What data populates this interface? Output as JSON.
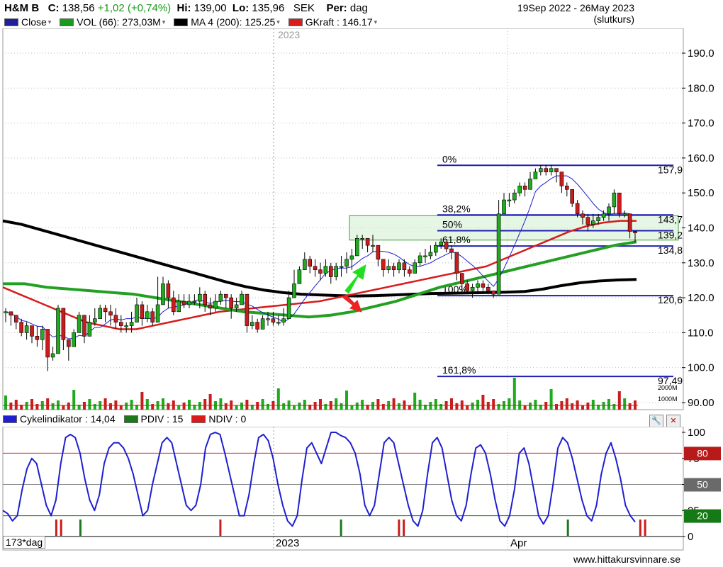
{
  "header": {
    "symbol": "H&M B",
    "close_label": "C:",
    "close_value": "138,56",
    "change": "+1,02 (+0,74%)",
    "hi_label": "Hi:",
    "hi_value": "139,00",
    "lo_label": "Lo:",
    "lo_value": "135,96",
    "currency": "SEK",
    "per_label": "Per:",
    "per_value": "dag",
    "date_range": "19Sep 2022 - 26May 2023",
    "price_type": "(slutkurs)"
  },
  "legend": [
    {
      "label": "Close",
      "color": "#1f1f9e"
    },
    {
      "label": "VOL (66): 273,03M",
      "color": "#1a9a1a"
    },
    {
      "label": "MA 4 (200): 125.25",
      "color": "#000000"
    },
    {
      "label": "GKraft : 146.17",
      "color": "#d81b1b"
    }
  ],
  "indicator_legend": [
    {
      "label": "Cykelindikator : 14,04",
      "color": "#1f1fd0"
    },
    {
      "label": "PDIV : 15",
      "color": "#1a7a1a"
    },
    {
      "label": "NDIV : 0",
      "color": "#d81b1b"
    }
  ],
  "period_label": "173*dag",
  "footer_site": "www.hittakursvinnare.se",
  "colors": {
    "up": "#1faa1f",
    "down": "#c81d1d",
    "ma200": "#000000",
    "green_ma": "#23a023",
    "red_ma": "#d81b1b",
    "blue": "#1f1fd0",
    "fib": "#1f1fb0",
    "zone": "#cfeecf"
  },
  "chart_data": [
    {
      "type": "line",
      "title": "H&M B",
      "ylim": [
        88,
        196
      ],
      "ytick_labels": [
        "190.0",
        "180.0",
        "170.0",
        "160.0",
        "150.0",
        "140.0",
        "130.0",
        "120.0",
        "110.0",
        "100.0",
        "90.00"
      ],
      "yticks": [
        190,
        180,
        170,
        160,
        150,
        140,
        130,
        120,
        110,
        100,
        90
      ],
      "xtick_labels": [
        "2023"
      ],
      "top_year_label": "2023",
      "candles": [
        [
          116,
          117,
          113
        ],
        [
          115,
          116,
          112
        ],
        [
          113,
          115,
          111
        ],
        [
          110,
          114,
          109
        ],
        [
          112,
          113,
          108
        ],
        [
          109,
          111,
          107
        ],
        [
          108,
          112,
          106
        ],
        [
          111,
          112,
          105
        ],
        [
          103,
          107,
          99
        ],
        [
          104,
          106,
          102
        ],
        [
          117,
          118,
          110
        ],
        [
          108,
          112,
          105
        ],
        [
          106,
          108,
          102
        ],
        [
          110,
          111,
          106
        ],
        [
          115,
          116,
          110
        ],
        [
          109,
          115,
          107
        ],
        [
          113,
          115,
          109
        ],
        [
          114,
          117,
          112
        ],
        [
          117,
          118,
          115
        ],
        [
          116,
          118,
          113
        ],
        [
          115,
          118,
          112
        ],
        [
          113,
          117,
          111
        ],
        [
          112,
          115,
          110
        ],
        [
          112,
          113,
          110
        ],
        [
          113,
          116,
          110
        ],
        [
          118,
          120,
          113
        ],
        [
          114,
          119,
          112
        ],
        [
          116,
          118,
          113
        ],
        [
          113,
          117,
          112
        ],
        [
          118,
          126,
          116
        ],
        [
          124,
          126,
          118
        ],
        [
          120,
          125,
          117
        ],
        [
          116,
          122,
          115
        ],
        [
          119,
          121,
          116
        ],
        [
          118,
          121,
          117
        ],
        [
          119,
          121,
          117
        ],
        [
          119,
          121,
          118
        ],
        [
          121,
          123,
          117
        ],
        [
          118,
          122,
          116
        ],
        [
          117,
          120,
          115
        ],
        [
          119,
          121,
          116
        ],
        [
          121,
          122,
          118
        ],
        [
          120,
          121,
          117
        ],
        [
          117,
          121,
          114
        ],
        [
          118,
          120,
          116
        ],
        [
          121,
          122,
          118
        ],
        [
          112,
          120,
          110
        ],
        [
          113,
          115,
          111
        ],
        [
          111,
          114,
          110
        ],
        [
          114,
          115,
          111
        ],
        [
          114,
          116,
          112
        ],
        [
          113,
          116,
          112
        ],
        [
          113,
          115,
          112
        ],
        [
          114,
          117,
          112
        ],
        [
          120,
          122,
          115
        ],
        [
          124,
          128,
          121
        ],
        [
          128,
          129,
          126
        ],
        [
          131,
          133,
          128
        ],
        [
          129,
          132,
          127
        ],
        [
          128,
          131,
          126
        ],
        [
          127,
          130,
          125
        ],
        [
          129,
          131,
          126
        ],
        [
          126,
          130,
          124
        ],
        [
          129,
          130,
          125
        ],
        [
          129,
          132,
          126
        ],
        [
          131,
          133,
          127
        ],
        [
          132,
          134,
          128
        ],
        [
          137,
          138,
          134
        ],
        [
          137,
          138,
          134
        ],
        [
          135,
          137,
          133
        ],
        [
          135,
          138,
          133
        ],
        [
          131,
          135,
          129
        ],
        [
          128,
          130,
          126
        ],
        [
          129,
          131,
          127
        ],
        [
          128,
          130,
          126
        ],
        [
          130,
          131,
          127
        ],
        [
          128,
          131,
          126
        ],
        [
          127,
          129,
          126
        ],
        [
          130,
          131,
          127
        ],
        [
          132,
          133,
          129
        ],
        [
          132,
          134,
          130
        ],
        [
          133,
          135,
          131
        ],
        [
          135,
          136,
          132
        ],
        [
          136,
          137,
          134
        ],
        [
          134,
          136,
          133
        ],
        [
          133,
          135,
          131
        ],
        [
          127,
          131,
          125
        ],
        [
          124,
          127,
          122
        ],
        [
          122,
          125,
          121
        ],
        [
          123,
          124,
          120
        ],
        [
          124,
          125,
          121
        ],
        [
          123,
          125,
          122
        ],
        [
          122,
          124,
          121
        ],
        [
          121,
          122,
          120
        ],
        [
          144,
          148,
          138
        ],
        [
          148,
          150,
          145
        ],
        [
          148,
          150,
          146
        ],
        [
          150,
          151,
          147
        ],
        [
          152,
          153,
          149
        ],
        [
          151,
          153,
          149
        ],
        [
          154,
          156,
          152
        ],
        [
          156,
          157,
          154
        ],
        [
          157,
          158,
          155
        ],
        [
          156,
          158,
          155
        ],
        [
          157,
          158,
          155
        ],
        [
          156,
          157,
          153
        ],
        [
          152,
          155,
          150
        ],
        [
          151,
          153,
          149
        ],
        [
          147,
          151,
          146
        ],
        [
          144,
          148,
          143
        ],
        [
          143,
          145,
          141
        ],
        [
          141,
          144,
          139
        ],
        [
          142,
          144,
          140
        ],
        [
          143,
          144,
          141
        ],
        [
          144,
          145,
          142
        ],
        [
          146,
          147,
          142
        ],
        [
          150,
          151,
          144
        ],
        [
          144,
          146,
          143
        ],
        [
          144,
          145,
          143
        ],
        [
          139,
          142,
          137
        ],
        [
          138.56,
          139,
          135.96
        ]
      ],
      "series": [
        {
          "name": "MA 4 (200)",
          "values": [
            142,
            141,
            139.5,
            138,
            136.5,
            135,
            133.5,
            132,
            130.5,
            129,
            127.5,
            126,
            124.5,
            123.2,
            122.2,
            121.5,
            121,
            120.8,
            120.6,
            120.5,
            120.6,
            120.8,
            121,
            121.2,
            121.3,
            121.4,
            121.5,
            121.6,
            121.8,
            122.5,
            123.5,
            124.3,
            124.8,
            125.1,
            125.25
          ]
        },
        {
          "name": "GKraft",
          "values": [
            123,
            121,
            119,
            117,
            115,
            113,
            112,
            111,
            111,
            112,
            113,
            114,
            115,
            116,
            116.5,
            117,
            117.5,
            118,
            118.5,
            119,
            120,
            121,
            122,
            123,
            124,
            125,
            126,
            127,
            128,
            129,
            131,
            133,
            135,
            137,
            139,
            140.5,
            141.5,
            142,
            142
          ]
        },
        {
          "name": "VOL (66)",
          "values": [
            124,
            124,
            123,
            122.5,
            122,
            121.5,
            121,
            120,
            119,
            118,
            117,
            116,
            115.5,
            115,
            114.5,
            115,
            116,
            117.5,
            119,
            121,
            123,
            124.5,
            126,
            127.5,
            129,
            130.5,
            132,
            133.5,
            135,
            136
          ]
        }
      ],
      "fibonacci": [
        {
          "label": "0%",
          "value": "157,9"
        },
        {
          "label": "38,2%",
          "value": "143,7"
        },
        {
          "label": "50%",
          "value": "139,2"
        },
        {
          "label": "61,8%",
          "value": "134,8"
        },
        {
          "label": "100%",
          "value": "120,6"
        },
        {
          "label": "161,8%",
          "value": "97,49"
        }
      ],
      "volume_labels": [
        "2000M",
        "1000M"
      ]
    },
    {
      "type": "line",
      "title": "Cykelindikator",
      "ylim": [
        0,
        100
      ],
      "yticks": [
        100,
        75,
        50,
        25,
        0
      ],
      "ytick_labels": [
        "100",
        "75",
        "50",
        "25",
        "0"
      ],
      "levels": [
        80,
        50,
        20
      ],
      "xtick_labels": [
        "2023",
        "Apr"
      ],
      "series": [
        {
          "name": "Cykelindikator",
          "values": [
            25,
            22,
            15,
            20,
            45,
            65,
            75,
            70,
            50,
            30,
            20,
            35,
            70,
            95,
            98,
            95,
            80,
            55,
            35,
            25,
            40,
            70,
            85,
            90,
            90,
            85,
            75,
            60,
            40,
            20,
            25,
            50,
            70,
            90,
            95,
            90,
            70,
            50,
            30,
            25,
            30,
            50,
            85,
            98,
            100,
            98,
            80,
            60,
            40,
            20,
            20,
            40,
            70,
            95,
            98,
            92,
            75,
            50,
            30,
            15,
            10,
            20,
            55,
            85,
            90,
            80,
            70,
            85,
            100,
            100,
            97,
            95,
            90,
            80,
            60,
            30,
            20,
            30,
            60,
            90,
            95,
            90,
            70,
            50,
            30,
            15,
            10,
            25,
            60,
            90,
            95,
            85,
            60,
            35,
            20,
            15,
            30,
            60,
            85,
            88,
            80,
            60,
            35,
            15,
            10,
            20,
            45,
            80,
            85,
            70,
            45,
            20,
            12,
            20,
            50,
            85,
            95,
            90,
            75,
            55,
            35,
            20,
            15,
            30,
            60,
            80,
            90,
            75,
            55,
            30,
            20,
            14
          ]
        }
      ],
      "pdiv_signals": [
        16,
        70,
        117,
        154,
        198,
        206
      ],
      "ndiv_signals": [
        11,
        12,
        45,
        82,
        83,
        132,
        133,
        163,
        164
      ]
    }
  ]
}
